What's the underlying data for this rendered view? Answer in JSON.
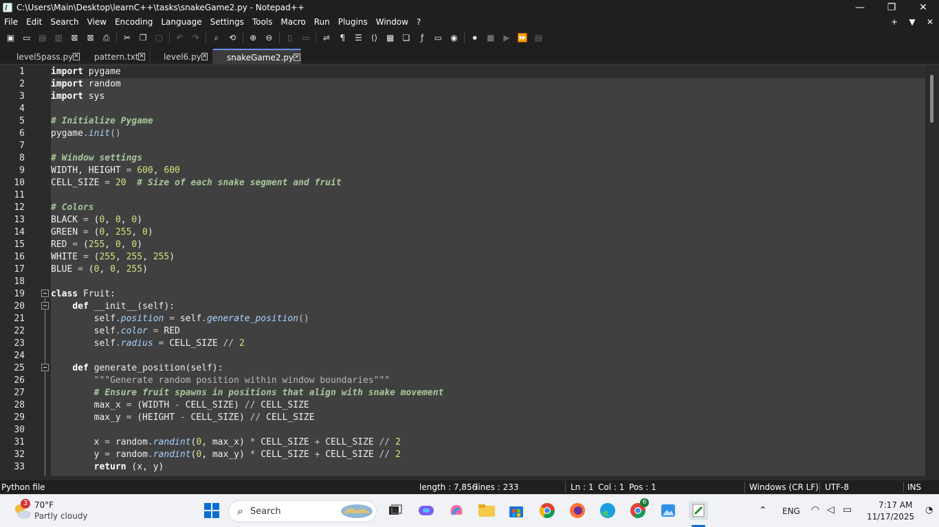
{
  "window": {
    "title": "C:\\Users\\Main\\Desktop\\learnC++\\tasks\\snakeGame2.py - Notepad++",
    "minimize_glyph": "—",
    "maximize_glyph": "❐",
    "close_glyph": "✕"
  },
  "menu": {
    "items": [
      "File",
      "Edit",
      "Search",
      "View",
      "Encoding",
      "Language",
      "Settings",
      "Tools",
      "Macro",
      "Run",
      "Plugins",
      "Window",
      "?"
    ],
    "right_glyphs": [
      "+",
      "▼",
      "✕"
    ]
  },
  "tabs": [
    {
      "label": "level5pass.py",
      "active": false
    },
    {
      "label": "pattern.txt",
      "active": false
    },
    {
      "label": "level6.py",
      "active": false
    },
    {
      "label": "snakeGame2.py",
      "active": true
    }
  ],
  "code_lines": [
    [
      {
        "t": "import",
        "c": "kw"
      },
      {
        "t": " pygame"
      }
    ],
    [
      {
        "t": "import",
        "c": "kw"
      },
      {
        "t": " random"
      }
    ],
    [
      {
        "t": "import",
        "c": "kw"
      },
      {
        "t": " sys"
      }
    ],
    [],
    [
      {
        "t": "# Initialize Pygame",
        "c": "cm"
      }
    ],
    [
      {
        "t": "pygame"
      },
      {
        "t": ".",
        "c": "op"
      },
      {
        "t": "init",
        "c": "fn"
      },
      {
        "t": "()",
        "c": "op"
      }
    ],
    [],
    [
      {
        "t": "# Window settings",
        "c": "cm"
      }
    ],
    [
      {
        "t": "WIDTH, HEIGHT "
      },
      {
        "t": "=",
        "c": "op"
      },
      {
        "t": " "
      },
      {
        "t": "600",
        "c": "num"
      },
      {
        "t": ", "
      },
      {
        "t": "600",
        "c": "num"
      }
    ],
    [
      {
        "t": "CELL_SIZE "
      },
      {
        "t": "=",
        "c": "op"
      },
      {
        "t": " "
      },
      {
        "t": "20",
        "c": "num"
      },
      {
        "t": "  "
      },
      {
        "t": "# Size of each snake segment and fruit",
        "c": "cm"
      }
    ],
    [],
    [
      {
        "t": "# Colors",
        "c": "cm"
      }
    ],
    [
      {
        "t": "BLACK "
      },
      {
        "t": "=",
        "c": "op"
      },
      {
        "t": " ("
      },
      {
        "t": "0",
        "c": "num"
      },
      {
        "t": ", "
      },
      {
        "t": "0",
        "c": "num"
      },
      {
        "t": ", "
      },
      {
        "t": "0",
        "c": "num"
      },
      {
        "t": ")"
      }
    ],
    [
      {
        "t": "GREEN "
      },
      {
        "t": "=",
        "c": "op"
      },
      {
        "t": " ("
      },
      {
        "t": "0",
        "c": "num"
      },
      {
        "t": ", "
      },
      {
        "t": "255",
        "c": "num"
      },
      {
        "t": ", "
      },
      {
        "t": "0",
        "c": "num"
      },
      {
        "t": ")"
      }
    ],
    [
      {
        "t": "RED "
      },
      {
        "t": "=",
        "c": "op"
      },
      {
        "t": " ("
      },
      {
        "t": "255",
        "c": "num"
      },
      {
        "t": ", "
      },
      {
        "t": "0",
        "c": "num"
      },
      {
        "t": ", "
      },
      {
        "t": "0",
        "c": "num"
      },
      {
        "t": ")"
      }
    ],
    [
      {
        "t": "WHITE "
      },
      {
        "t": "=",
        "c": "op"
      },
      {
        "t": " ("
      },
      {
        "t": "255",
        "c": "num"
      },
      {
        "t": ", "
      },
      {
        "t": "255",
        "c": "num"
      },
      {
        "t": ", "
      },
      {
        "t": "255",
        "c": "num"
      },
      {
        "t": ")"
      }
    ],
    [
      {
        "t": "BLUE "
      },
      {
        "t": "=",
        "c": "op"
      },
      {
        "t": " ("
      },
      {
        "t": "0",
        "c": "num"
      },
      {
        "t": ", "
      },
      {
        "t": "0",
        "c": "num"
      },
      {
        "t": ", "
      },
      {
        "t": "255",
        "c": "num"
      },
      {
        "t": ")"
      }
    ],
    [],
    [
      {
        "t": "class",
        "c": "kw"
      },
      {
        "t": " Fruit:"
      }
    ],
    [
      {
        "t": "    "
      },
      {
        "t": "def",
        "c": "kw"
      },
      {
        "t": " __init__(self):"
      }
    ],
    [
      {
        "t": "        self"
      },
      {
        "t": ".",
        "c": "op"
      },
      {
        "t": "position",
        "c": "fn"
      },
      {
        "t": " "
      },
      {
        "t": "=",
        "c": "op"
      },
      {
        "t": " self"
      },
      {
        "t": ".",
        "c": "op"
      },
      {
        "t": "generate_position",
        "c": "fn"
      },
      {
        "t": "()",
        "c": "op"
      }
    ],
    [
      {
        "t": "        self"
      },
      {
        "t": ".",
        "c": "op"
      },
      {
        "t": "color",
        "c": "fn"
      },
      {
        "t": " "
      },
      {
        "t": "=",
        "c": "op"
      },
      {
        "t": " RED"
      }
    ],
    [
      {
        "t": "        self"
      },
      {
        "t": ".",
        "c": "op"
      },
      {
        "t": "radius",
        "c": "fn"
      },
      {
        "t": " "
      },
      {
        "t": "=",
        "c": "op"
      },
      {
        "t": " CELL_SIZE "
      },
      {
        "t": "//",
        "c": "op"
      },
      {
        "t": " "
      },
      {
        "t": "2",
        "c": "num"
      }
    ],
    [],
    [
      {
        "t": "    "
      },
      {
        "t": "def",
        "c": "kw"
      },
      {
        "t": " generate_position(self):"
      }
    ],
    [
      {
        "t": "        "
      },
      {
        "t": "\"\"\"Generate random position within window boundaries\"\"\"",
        "c": "str"
      }
    ],
    [
      {
        "t": "        "
      },
      {
        "t": "# Ensure fruit spawns in positions that align with snake movement",
        "c": "cm"
      }
    ],
    [
      {
        "t": "        max_x "
      },
      {
        "t": "=",
        "c": "op"
      },
      {
        "t": " (WIDTH "
      },
      {
        "t": "-",
        "c": "op"
      },
      {
        "t": " CELL_SIZE) "
      },
      {
        "t": "//",
        "c": "op"
      },
      {
        "t": " CELL_SIZE"
      }
    ],
    [
      {
        "t": "        max_y "
      },
      {
        "t": "=",
        "c": "op"
      },
      {
        "t": " (HEIGHT "
      },
      {
        "t": "-",
        "c": "op"
      },
      {
        "t": " CELL_SIZE) "
      },
      {
        "t": "//",
        "c": "op"
      },
      {
        "t": " CELL_SIZE"
      }
    ],
    [],
    [
      {
        "t": "        x "
      },
      {
        "t": "=",
        "c": "op"
      },
      {
        "t": " random"
      },
      {
        "t": ".",
        "c": "op"
      },
      {
        "t": "randint",
        "c": "fn"
      },
      {
        "t": "("
      },
      {
        "t": "0",
        "c": "num"
      },
      {
        "t": ", max_x) "
      },
      {
        "t": "*",
        "c": "op"
      },
      {
        "t": " CELL_SIZE "
      },
      {
        "t": "+",
        "c": "op"
      },
      {
        "t": " CELL_SIZE "
      },
      {
        "t": "//",
        "c": "op"
      },
      {
        "t": " "
      },
      {
        "t": "2",
        "c": "num"
      }
    ],
    [
      {
        "t": "        y "
      },
      {
        "t": "=",
        "c": "op"
      },
      {
        "t": " random"
      },
      {
        "t": ".",
        "c": "op"
      },
      {
        "t": "randint",
        "c": "fn"
      },
      {
        "t": "("
      },
      {
        "t": "0",
        "c": "num"
      },
      {
        "t": ", max_y) "
      },
      {
        "t": "*",
        "c": "op"
      },
      {
        "t": " CELL_SIZE "
      },
      {
        "t": "+",
        "c": "op"
      },
      {
        "t": " CELL_SIZE "
      },
      {
        "t": "//",
        "c": "op"
      },
      {
        "t": " "
      },
      {
        "t": "2",
        "c": "num"
      }
    ],
    [
      {
        "t": "        "
      },
      {
        "t": "return",
        "c": "kw"
      },
      {
        "t": " (x, y)"
      }
    ]
  ],
  "status": {
    "language": "Python file",
    "length": "length : 7,856",
    "lines": "lines : 233",
    "ln": "Ln : 1",
    "col": "Col : 1",
    "pos": "Pos : 1",
    "eol": "Windows (CR LF)",
    "encoding": "UTF-8",
    "mode": "INS"
  },
  "taskbar": {
    "weather_temp": "70°F",
    "weather_desc": "Partly cloudy",
    "weather_badge": "3",
    "search_placeholder": "Search",
    "chrome_badge": "6",
    "lang": "ENG",
    "time": "7:17 AM",
    "date": "11/17/2025"
  },
  "colors": {
    "keyword": "#ffffff",
    "comment": "#a7c89a",
    "number": "#d5e27c",
    "function": "#a8d4ff",
    "active_tab_accent": "#6a8ff0"
  }
}
